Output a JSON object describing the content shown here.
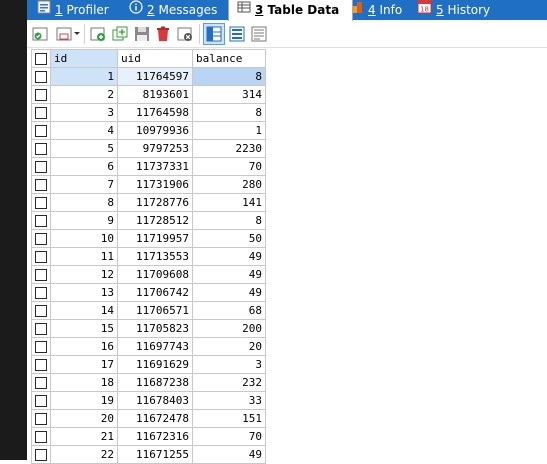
{
  "tabs": [
    {
      "num": "1",
      "label": "Profiler",
      "icon": "profiler-icon",
      "active": false
    },
    {
      "num": "2",
      "label": "Messages",
      "icon": "info-circle-icon",
      "active": false
    },
    {
      "num": "3",
      "label": "Table Data",
      "icon": "table-icon",
      "active": true
    },
    {
      "num": "4",
      "label": "Info",
      "icon": "info-flag-icon",
      "active": false
    },
    {
      "num": "5",
      "label": "History",
      "icon": "calendar-icon",
      "calendar_day": "18",
      "active": false
    }
  ],
  "grid": {
    "columns": [
      "id",
      "uid",
      "balance"
    ],
    "rows": [
      {
        "id": "1",
        "uid": "11764597",
        "balance": "8"
      },
      {
        "id": "2",
        "uid": "8193601",
        "balance": "314"
      },
      {
        "id": "3",
        "uid": "11764598",
        "balance": "8"
      },
      {
        "id": "4",
        "uid": "10979936",
        "balance": "1"
      },
      {
        "id": "5",
        "uid": "9797253",
        "balance": "2230"
      },
      {
        "id": "6",
        "uid": "11737331",
        "balance": "70"
      },
      {
        "id": "7",
        "uid": "11731906",
        "balance": "280"
      },
      {
        "id": "8",
        "uid": "11728776",
        "balance": "141"
      },
      {
        "id": "9",
        "uid": "11728512",
        "balance": "8"
      },
      {
        "id": "10",
        "uid": "11719957",
        "balance": "50"
      },
      {
        "id": "11",
        "uid": "11713553",
        "balance": "49"
      },
      {
        "id": "12",
        "uid": "11709608",
        "balance": "49"
      },
      {
        "id": "13",
        "uid": "11706742",
        "balance": "49"
      },
      {
        "id": "14",
        "uid": "11706571",
        "balance": "68"
      },
      {
        "id": "15",
        "uid": "11705823",
        "balance": "200"
      },
      {
        "id": "16",
        "uid": "11697743",
        "balance": "20"
      },
      {
        "id": "17",
        "uid": "11691629",
        "balance": "3"
      },
      {
        "id": "18",
        "uid": "11687238",
        "balance": "232"
      },
      {
        "id": "19",
        "uid": "11678403",
        "balance": "33"
      },
      {
        "id": "20",
        "uid": "11672478",
        "balance": "151"
      },
      {
        "id": "21",
        "uid": "11672316",
        "balance": "70"
      },
      {
        "id": "22",
        "uid": "11671255",
        "balance": "49"
      }
    ]
  },
  "colors": {
    "tabbar": "#1f6fc5",
    "selection": "#b9d5f3"
  }
}
